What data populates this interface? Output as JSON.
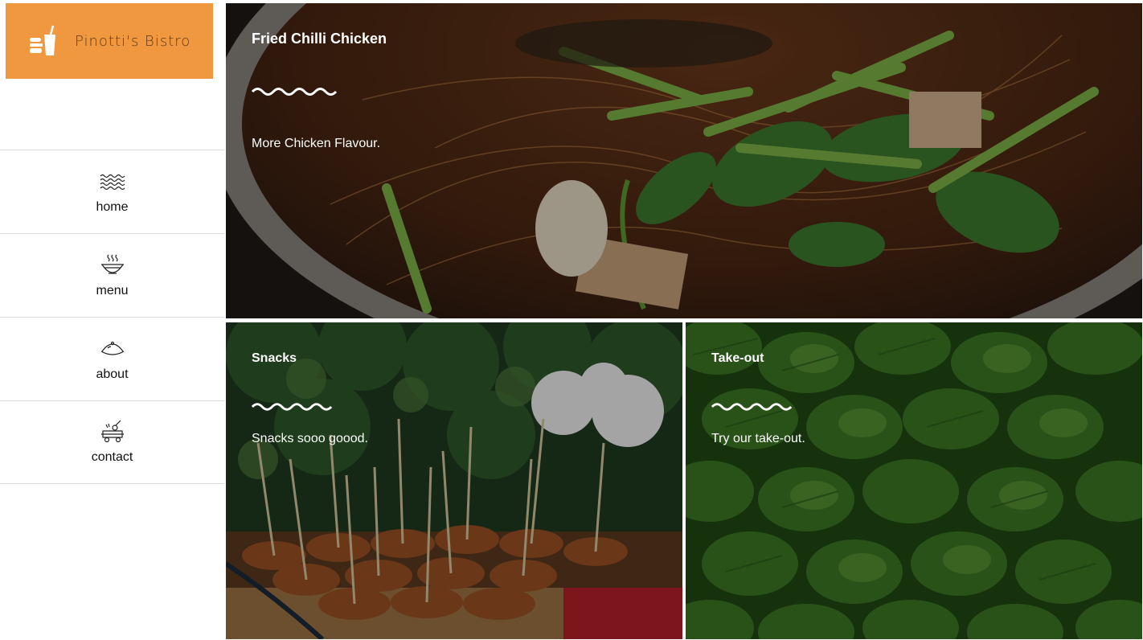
{
  "brand": {
    "name": "Pinotti's Bistro",
    "color": "#f0983f"
  },
  "nav": [
    {
      "label": "home",
      "icon": "waves-icon"
    },
    {
      "label": "menu",
      "icon": "steaming-bowl-icon"
    },
    {
      "label": "about",
      "icon": "cloche-icon"
    },
    {
      "label": "contact",
      "icon": "grill-icon"
    }
  ],
  "tiles": {
    "hero": {
      "title": "Fried Chilli Chicken",
      "text": "More Chicken Flavour."
    },
    "snacks": {
      "title": "Snacks",
      "text": "Snacks sooo goood."
    },
    "takeout": {
      "title": "Take-out",
      "text": "Try our take-out."
    }
  }
}
